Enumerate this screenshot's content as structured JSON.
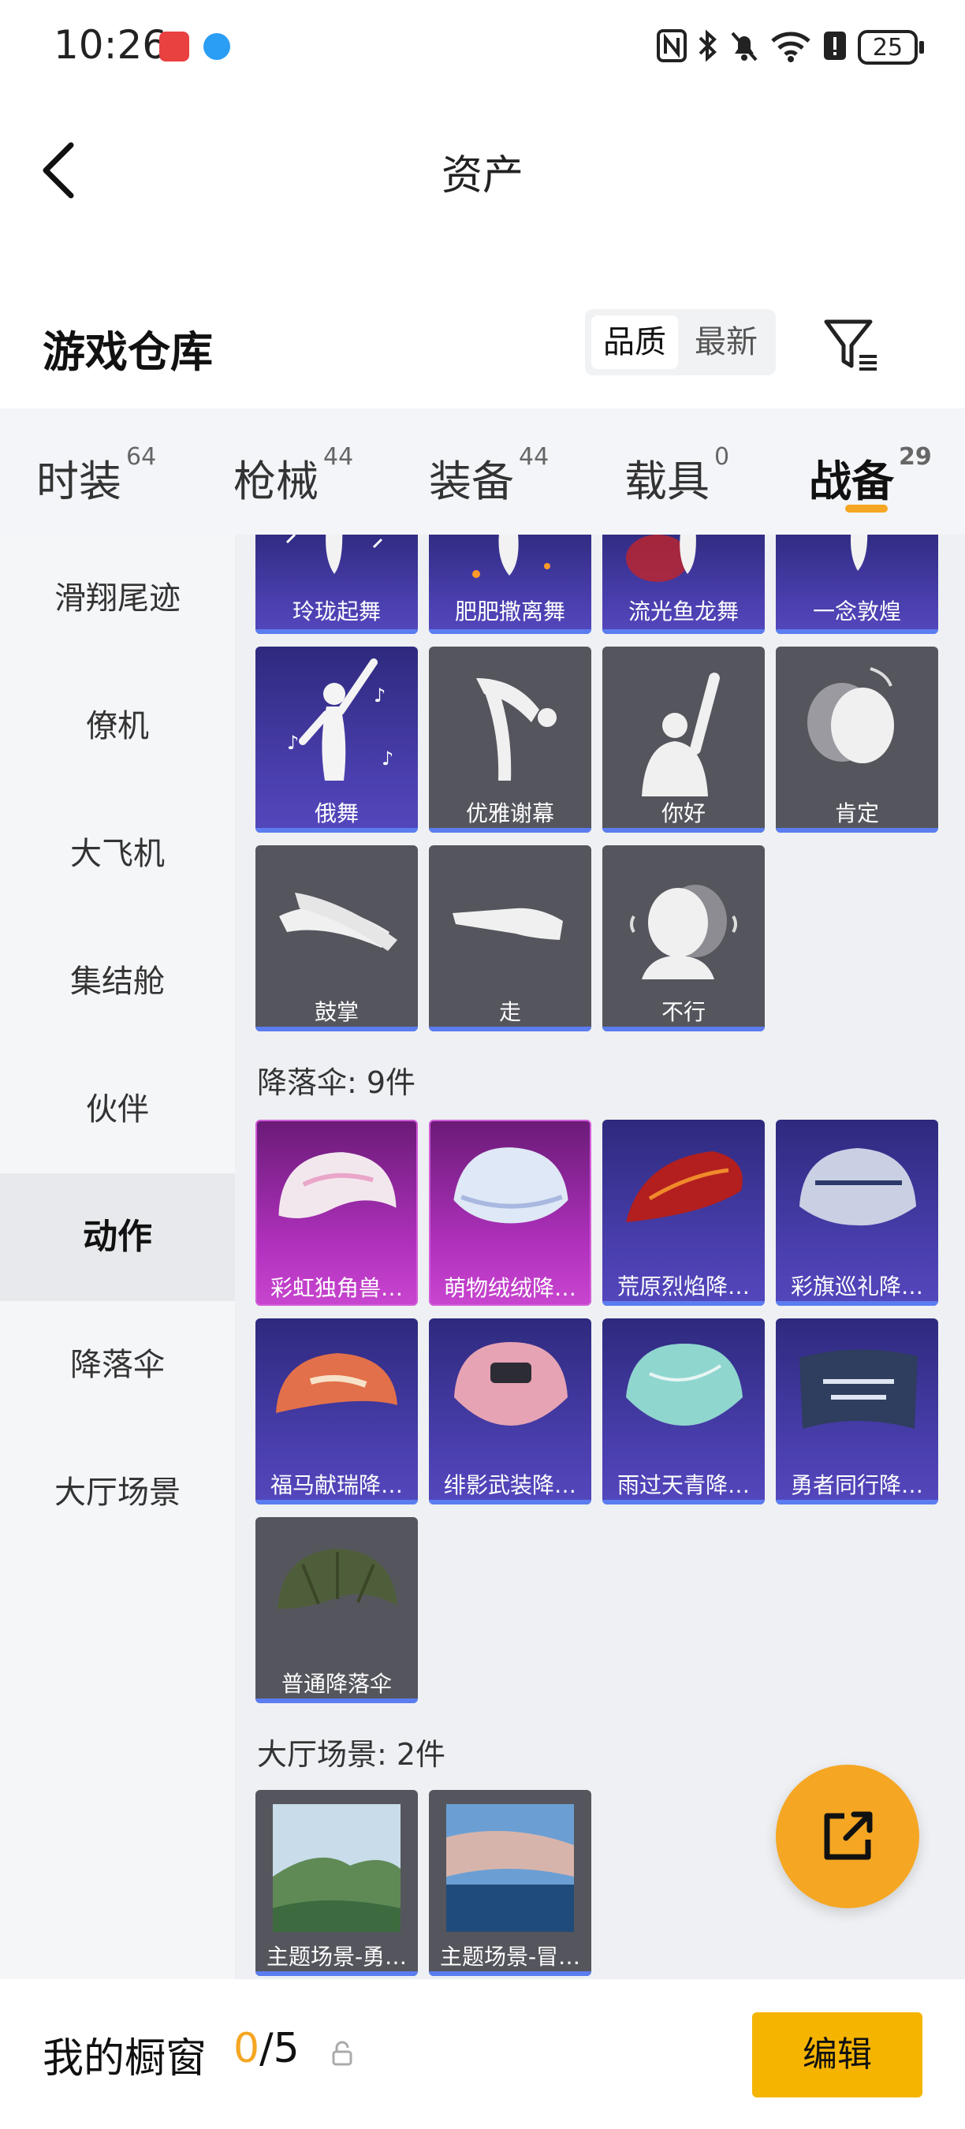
{
  "status_bar": {
    "time": "10:26",
    "battery": "25",
    "icons": [
      "nfc-icon",
      "bluetooth-icon",
      "mute-icon",
      "wifi-icon",
      "alert-icon",
      "battery-icon"
    ]
  },
  "header": {
    "title": "资产",
    "back_icon": "chevron-left-icon"
  },
  "warehouse": {
    "title": "游戏仓库",
    "sort_options": [
      "品质",
      "最新"
    ],
    "selected_sort": "品质",
    "filter_icon": "filter-icon"
  },
  "categories": [
    {
      "label": "时装",
      "count": "64"
    },
    {
      "label": "枪械",
      "count": "44"
    },
    {
      "label": "装备",
      "count": "44"
    },
    {
      "label": "载具",
      "count": "0"
    },
    {
      "label": "战备",
      "count": "29"
    }
  ],
  "active_category": "战备",
  "sidebar": {
    "items": [
      "滑翔尾迹",
      "僚机",
      "大飞机",
      "集结舱",
      "伙伴",
      "动作",
      "降落伞",
      "大厅场景"
    ],
    "active": "动作"
  },
  "actions_row1": [
    "玲珑起舞",
    "肥肥撒离舞",
    "流光鱼龙舞",
    "一念敦煌"
  ],
  "actions_row2": [
    "俄舞",
    "优雅谢幕",
    "你好",
    "肯定"
  ],
  "actions_row3": [
    "鼓掌",
    "走",
    "不行"
  ],
  "parachute": {
    "heading": "降落伞: 9件",
    "items": [
      "彩虹独角兽…",
      "萌物绒绒降…",
      "荒原烈焰降…",
      "彩旗巡礼降…",
      "福马献瑞降…",
      "绯影武装降…",
      "雨过天青降…",
      "勇者同行降…",
      "普通降落伞"
    ]
  },
  "lobby": {
    "heading": "大厅场景: 2件",
    "items": [
      "主题场景-勇…",
      "主题场景-冒…"
    ]
  },
  "bottom_bar": {
    "title": "我的橱窗",
    "current": "0",
    "total": "/5",
    "edit_label": "编辑"
  },
  "colors": {
    "accent": "#f5a623",
    "edit_button": "#f5b400",
    "card_purple": "#4a3fae",
    "card_gray": "#55565d",
    "card_pink": "#b232bf",
    "card_bar": "#5b7df0"
  }
}
